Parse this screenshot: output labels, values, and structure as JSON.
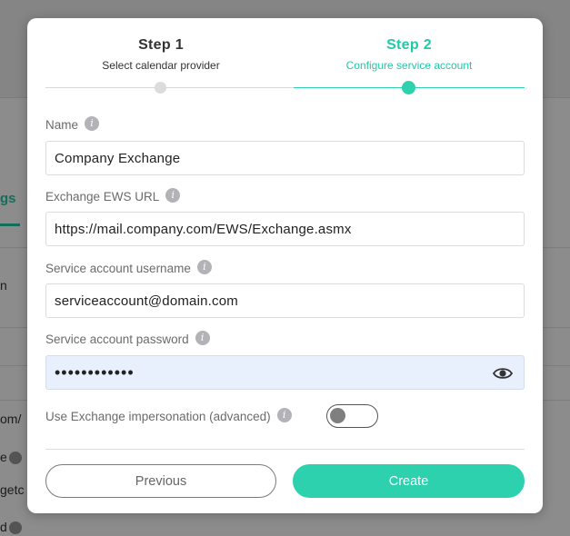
{
  "background": {
    "tab_fragment": "gs",
    "row_fragments": [
      "n",
      "om/",
      "e",
      "getc",
      "d"
    ]
  },
  "stepper": {
    "steps": [
      {
        "title": "Step 1",
        "subtitle": "Select calendar provider",
        "active": false
      },
      {
        "title": "Step 2",
        "subtitle": "Configure service account",
        "active": true
      }
    ]
  },
  "form": {
    "name": {
      "label": "Name",
      "value": "Company Exchange"
    },
    "ews_url": {
      "label": "Exchange EWS URL",
      "value": "https://mail.company.com/EWS/Exchange.asmx"
    },
    "username": {
      "label": "Service account username",
      "value": "serviceaccount@domain.com"
    },
    "password": {
      "label": "Service account password",
      "value": "••••••••••••"
    },
    "impersonation": {
      "label": "Use Exchange impersonation (advanced)",
      "enabled": false
    },
    "info_glyph": "i"
  },
  "buttons": {
    "previous": "Previous",
    "create": "Create"
  },
  "colors": {
    "accent": "#2dd1ad",
    "active_text": "#23c9a6",
    "password_bg": "#e8f0fe"
  }
}
